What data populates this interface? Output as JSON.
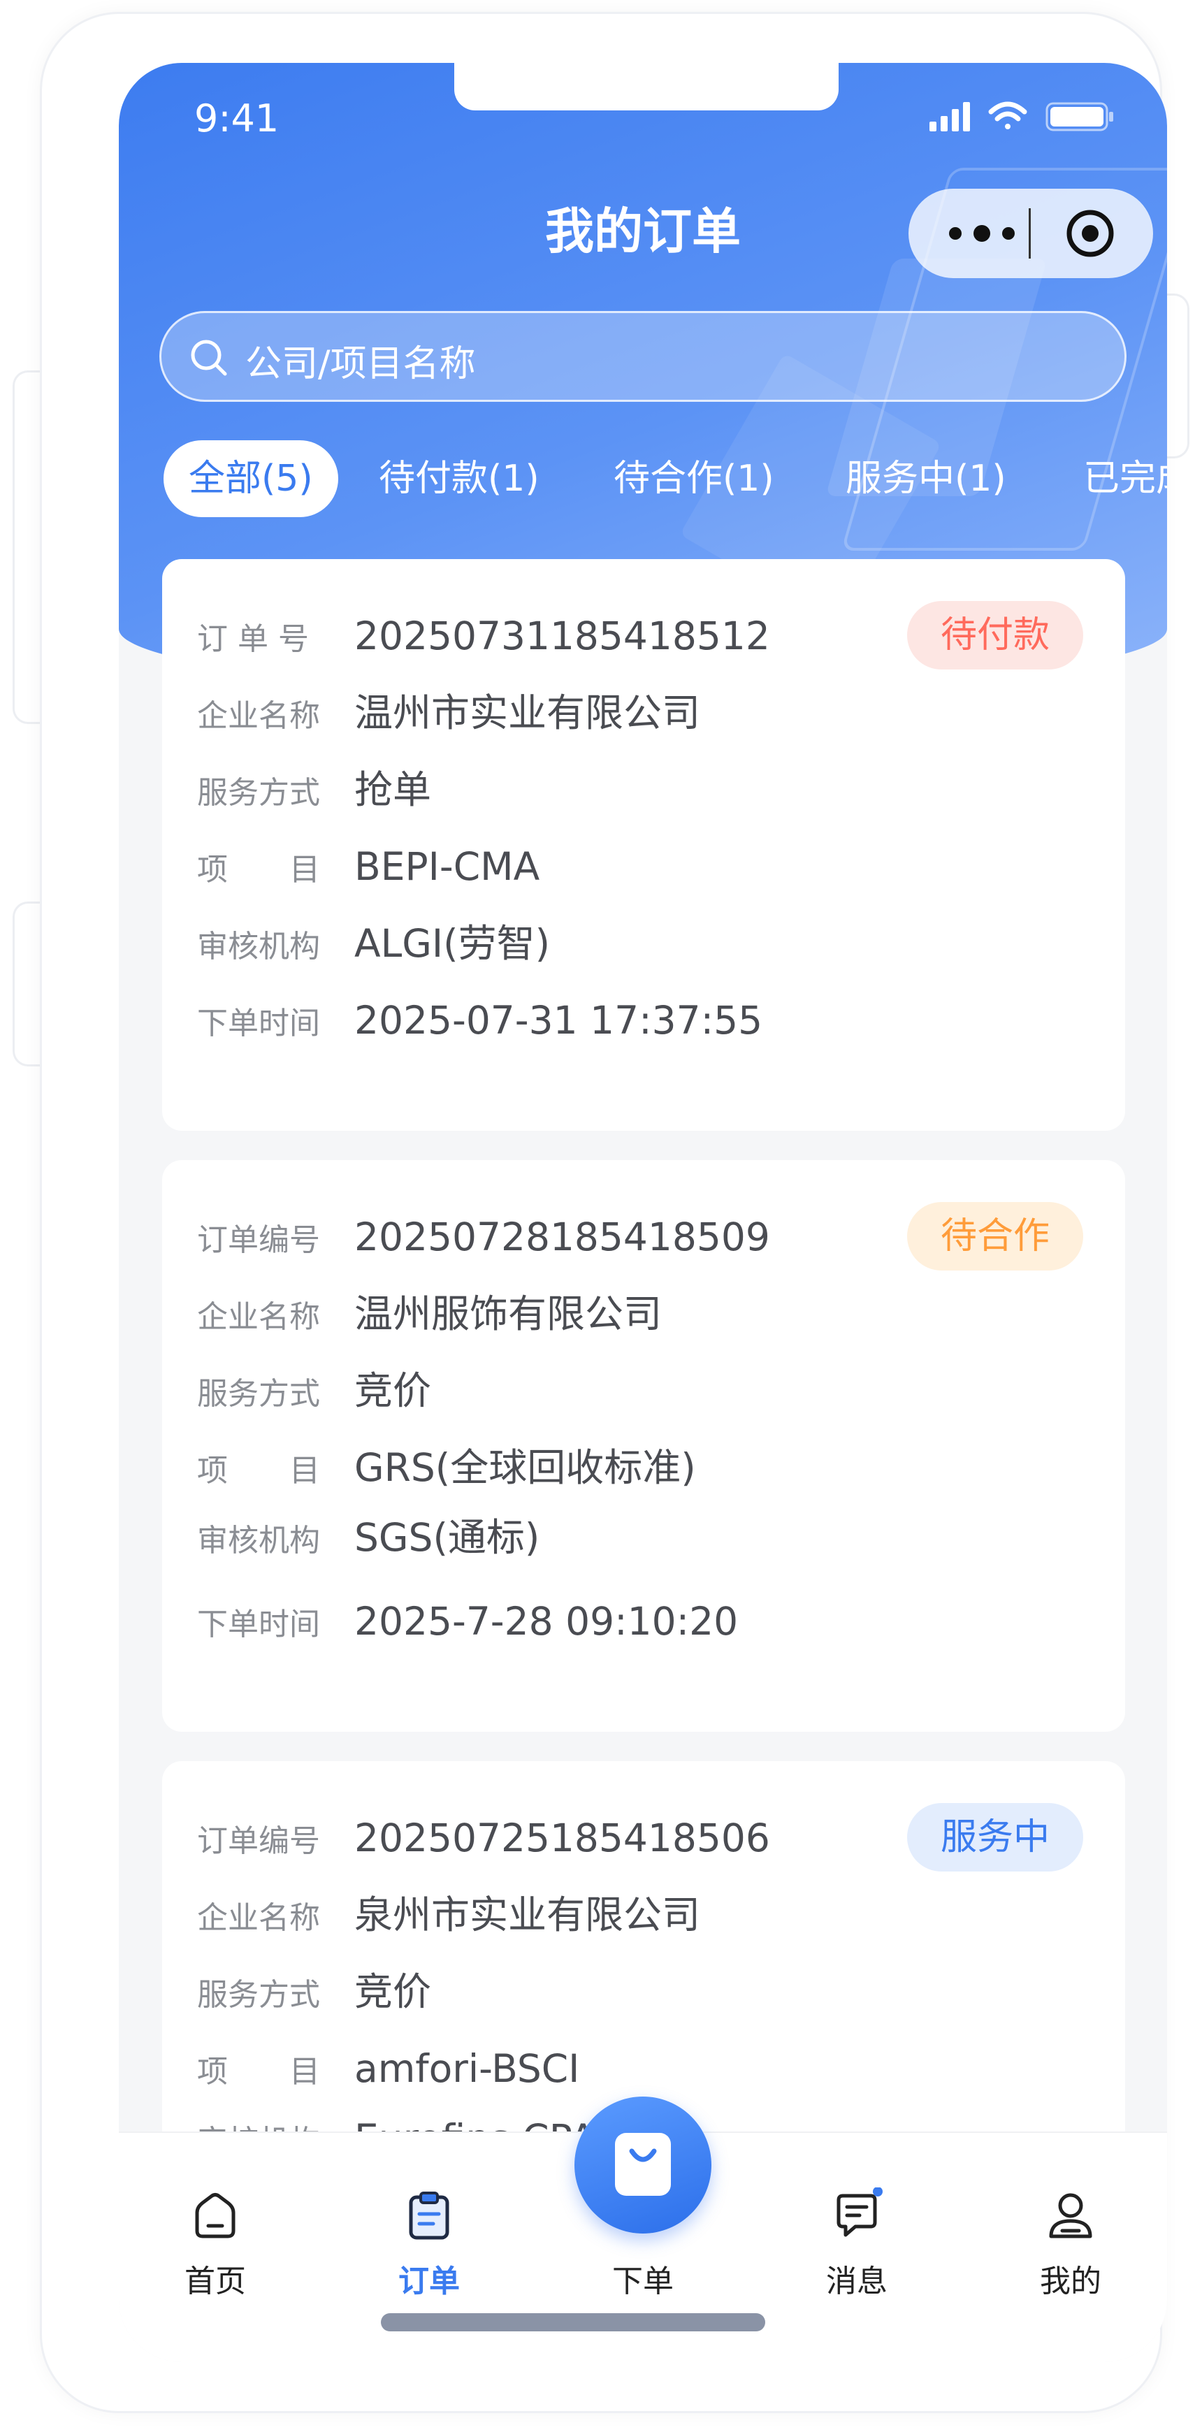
{
  "status_bar": {
    "time": "9:41"
  },
  "header": {
    "title": "我的订单"
  },
  "search": {
    "placeholder": "公司/项目名称"
  },
  "tabs": [
    "全部(5)",
    "待付款(1)",
    "待合作(1)",
    "服务中(1)",
    "已完成"
  ],
  "orders": [
    {
      "rows": [
        {
          "label": "订 单 号",
          "value": "20250731185418512"
        },
        {
          "label": "企业名称",
          "value": "温州市实业有限公司"
        },
        {
          "label": "服务方式",
          "value": "抢单"
        },
        {
          "label": "项　　目",
          "value": "BEPI-CMA"
        },
        {
          "label": "审核机构",
          "value": "ALGI(劳智)"
        },
        {
          "label": "下单时间",
          "value": "2025-07-31 17:37:55"
        }
      ],
      "status": "待付款",
      "status_color": "#ff6a5c",
      "status_bg": "#fde6e3"
    },
    {
      "rows": [
        {
          "label": "订单编号",
          "value": "20250728185418509"
        },
        {
          "label": "企业名称",
          "value": "温州服饰有限公司"
        },
        {
          "label": "服务方式",
          "value": "竞价"
        },
        {
          "label": "项　　目",
          "value": "GRS(全球回收标准)"
        },
        {
          "label": "审核机构",
          "value": "SGS(通标)"
        },
        {
          "label": "下单时间",
          "value": "2025-7-28 09:10:20"
        }
      ],
      "status": "待合作",
      "status_color": "#ff9c3a",
      "status_bg": "#fff0dc"
    },
    {
      "rows": [
        {
          "label": "订单编号",
          "value": "20250725185418506"
        },
        {
          "label": "企业名称",
          "value": "泉州市实业有限公司"
        },
        {
          "label": "服务方式",
          "value": "竞价"
        },
        {
          "label": "项　　目",
          "value": "amfori-BSCI"
        },
        {
          "label": "审核机构",
          "value": "Eurofins CPA(...)"
        }
      ],
      "status": "服务中",
      "status_color": "#3a7bef",
      "status_bg": "#e3edfd"
    }
  ],
  "tabbar": {
    "items": [
      {
        "label": "首页",
        "icon": "home-icon"
      },
      {
        "label": "订单",
        "icon": "clipboard-icon"
      },
      {
        "label": "下单",
        "icon": "shopping-bag-icon"
      },
      {
        "label": "消息",
        "icon": "message-icon"
      },
      {
        "label": "我的",
        "icon": "user-icon"
      }
    ],
    "active_color": "#3a7bef"
  }
}
